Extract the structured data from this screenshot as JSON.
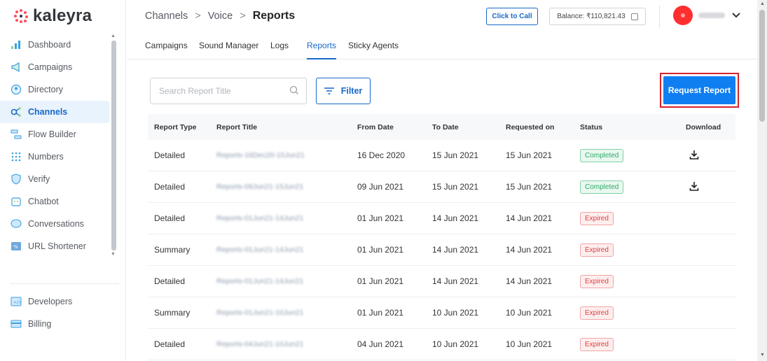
{
  "logo": {
    "text": "kaleyra",
    "brand_color": "#ff4d5e"
  },
  "sidebar": {
    "items": [
      {
        "label": "Dashboard",
        "icon": "bar-chart-icon"
      },
      {
        "label": "Campaigns",
        "icon": "megaphone-icon"
      },
      {
        "label": "Directory",
        "icon": "contact-icon"
      },
      {
        "label": "Channels",
        "icon": "channels-icon",
        "active": true
      },
      {
        "label": "Flow Builder",
        "icon": "flow-icon"
      },
      {
        "label": "Numbers",
        "icon": "dialpad-icon"
      },
      {
        "label": "Verify",
        "icon": "shield-icon"
      },
      {
        "label": "Chatbot",
        "icon": "chatbot-icon"
      },
      {
        "label": "Conversations",
        "icon": "chat-bubble-icon"
      },
      {
        "label": "URL Shortener",
        "icon": "link-icon"
      }
    ],
    "bottom_items": [
      {
        "label": "Developers",
        "icon": "code-icon"
      },
      {
        "label": "Billing",
        "icon": "card-icon"
      }
    ]
  },
  "header": {
    "breadcrumb": [
      "Channels",
      "Voice",
      "Reports"
    ],
    "separator": ">",
    "click_to_call": "Click to Call",
    "balance": "Balance: ₹110,821.43"
  },
  "tabs": [
    "Campaigns",
    "Sound Manager",
    "Logs",
    "Reports",
    "Sticky Agents"
  ],
  "active_tab": "Reports",
  "toolbar": {
    "search_placeholder": "Search Report Title",
    "filter_label": "Filter",
    "request_label": "Request Report"
  },
  "table": {
    "headers": [
      "Report Type",
      "Report Title",
      "From Date",
      "To Date",
      "Requested on",
      "Status",
      "Download"
    ],
    "rows": [
      {
        "type": "Detailed",
        "title": "Reports-16Dec20-15Jun21",
        "from": "16 Dec 2020",
        "to": "15 Jun 2021",
        "requested": "15 Jun 2021",
        "status": "Completed",
        "download": true
      },
      {
        "type": "Detailed",
        "title": "Reports-09Jun21-15Jun21",
        "from": "09 Jun 2021",
        "to": "15 Jun 2021",
        "requested": "15 Jun 2021",
        "status": "Completed",
        "download": true
      },
      {
        "type": "Detailed",
        "title": "Reports-01Jun21-14Jun21",
        "from": "01 Jun 2021",
        "to": "14 Jun 2021",
        "requested": "14 Jun 2021",
        "status": "Expired",
        "download": false
      },
      {
        "type": "Summary",
        "title": "Reports-01Jun21-14Jun21",
        "from": "01 Jun 2021",
        "to": "14 Jun 2021",
        "requested": "14 Jun 2021",
        "status": "Expired",
        "download": false
      },
      {
        "type": "Detailed",
        "title": "Reports-01Jun21-14Jun21",
        "from": "01 Jun 2021",
        "to": "14 Jun 2021",
        "requested": "14 Jun 2021",
        "status": "Expired",
        "download": false
      },
      {
        "type": "Summary",
        "title": "Reports-01Jun21-10Jun21",
        "from": "01 Jun 2021",
        "to": "10 Jun 2021",
        "requested": "10 Jun 2021",
        "status": "Expired",
        "download": false
      },
      {
        "type": "Detailed",
        "title": "Reports-04Jun21-10Jun21",
        "from": "04 Jun 2021",
        "to": "10 Jun 2021",
        "requested": "10 Jun 2021",
        "status": "Expired",
        "download": false
      }
    ]
  },
  "colors": {
    "accent": "#1769c9",
    "primary_button": "#0f7ef0",
    "highlight_outline": "#d7222b",
    "completed": "#2eaa6b",
    "expired": "#e04040"
  }
}
